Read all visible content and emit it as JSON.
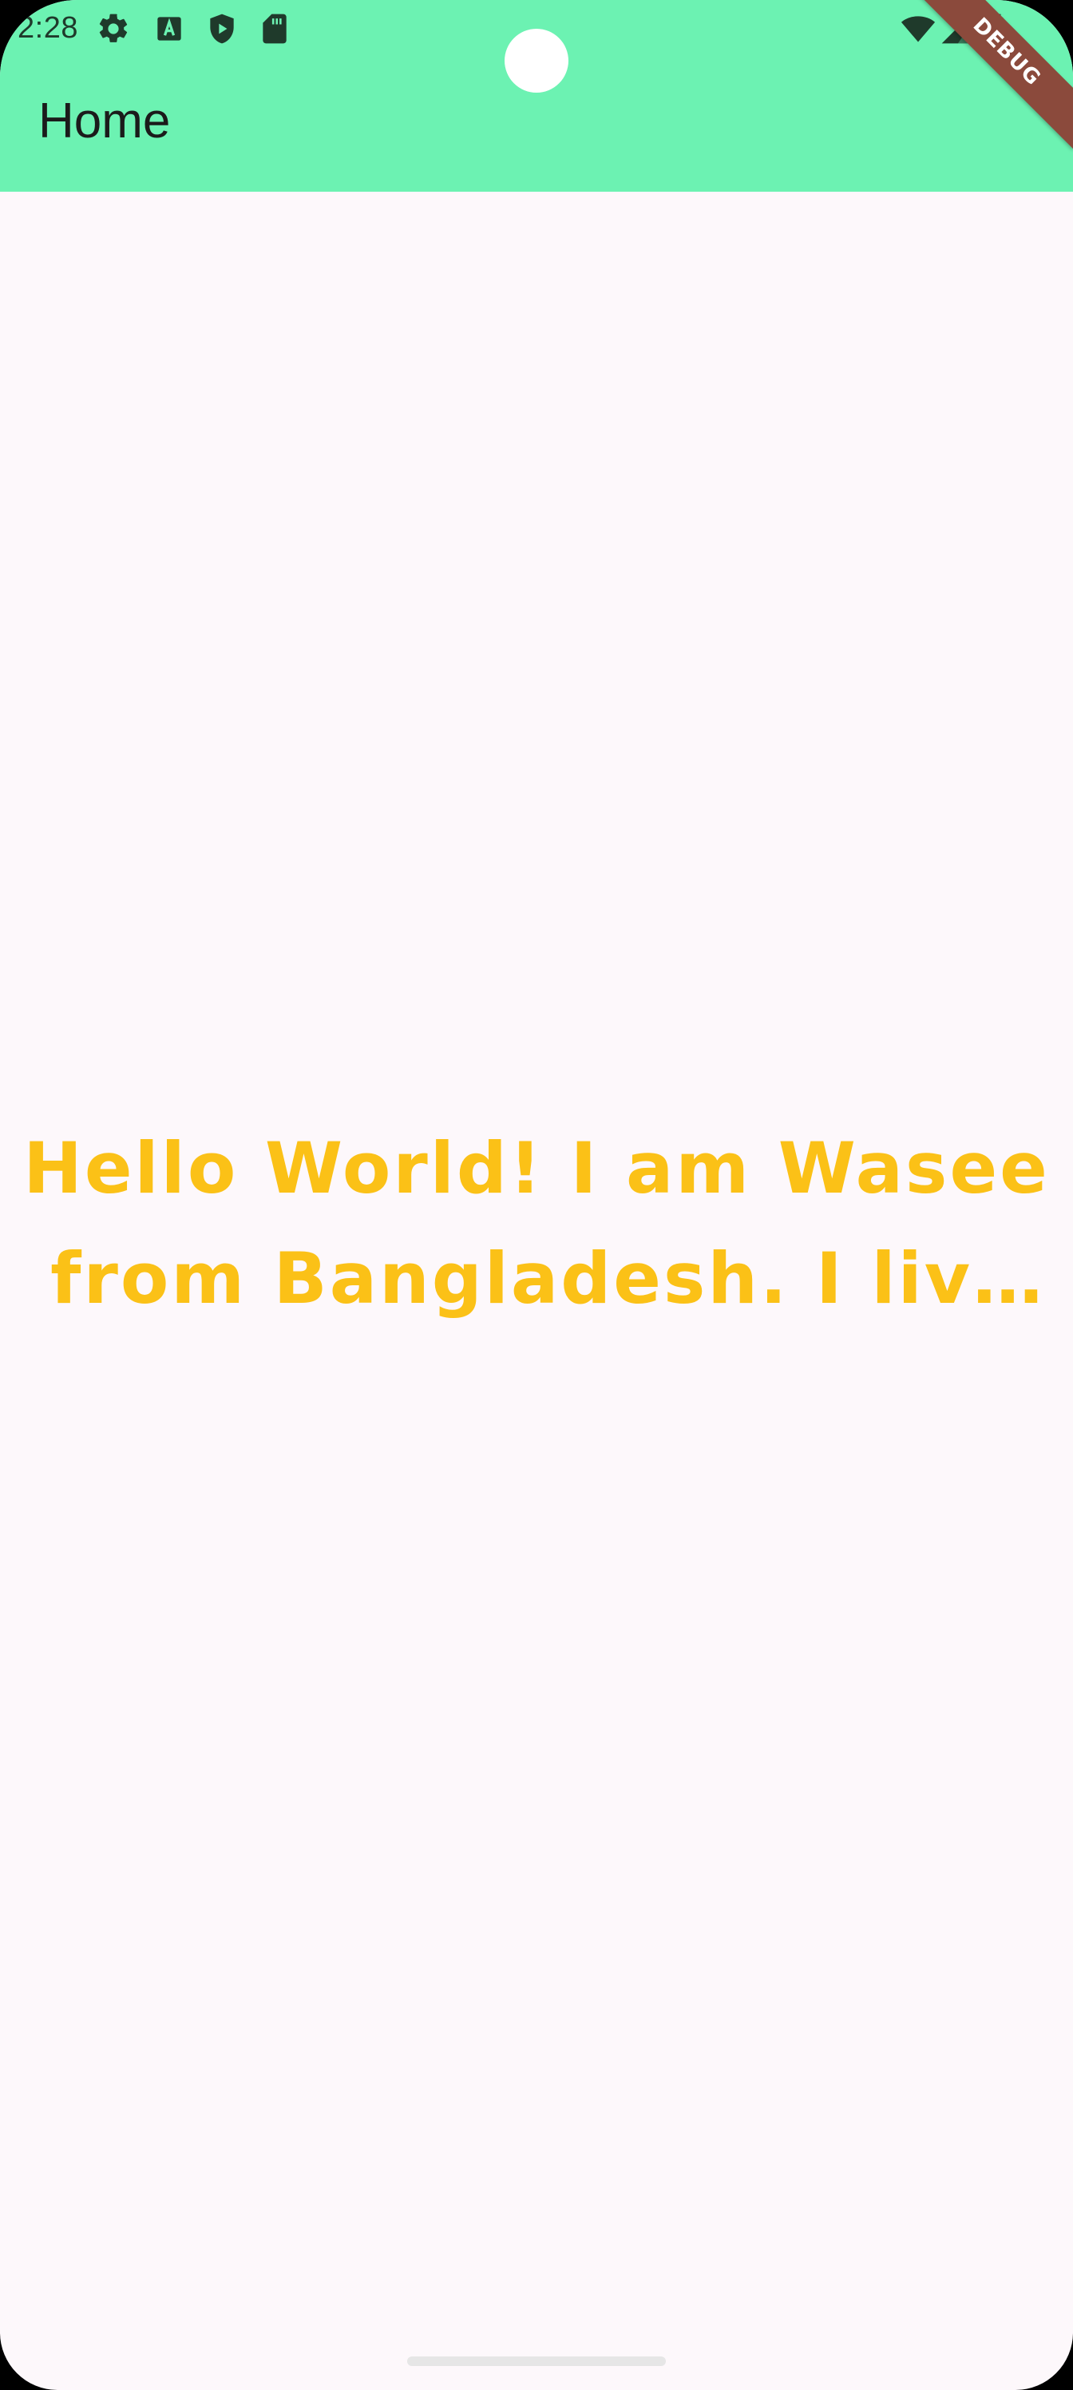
{
  "status_bar": {
    "time": "2:28",
    "left_icons": [
      "gear-icon",
      "a-text-icon",
      "shield-play-icon",
      "sd-card-icon"
    ],
    "right_icons": [
      "wifi-icon",
      "cell-signal-icon",
      "battery-icon"
    ]
  },
  "debug_banner": {
    "label": "DEBUG"
  },
  "app_bar": {
    "title": "Home",
    "color": "#6cf2b2"
  },
  "body": {
    "text": "Hello World! I am Wasee from Bangladesh. I live in …",
    "text_color": "#fbc117",
    "background": "#fdf8fb"
  }
}
